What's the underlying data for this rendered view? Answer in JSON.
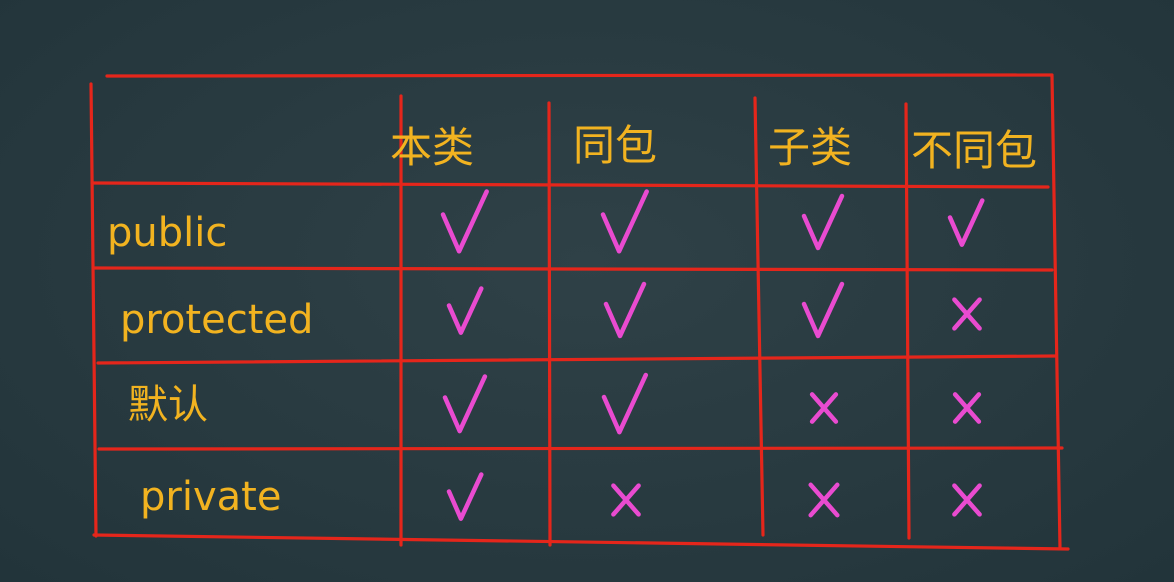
{
  "table": {
    "columns": [
      "本类",
      "同包",
      "子类",
      "不同包"
    ],
    "rows": [
      {
        "label": "public",
        "access": [
          true,
          true,
          true,
          true
        ]
      },
      {
        "label": "protected",
        "access": [
          true,
          true,
          true,
          false
        ]
      },
      {
        "label": "默认",
        "access": [
          true,
          true,
          false,
          false
        ]
      },
      {
        "label": "private",
        "access": [
          true,
          false,
          false,
          false
        ]
      }
    ]
  },
  "colors": {
    "board": "#283a40",
    "grid_lines": "#e5261b",
    "text": "#f2b320",
    "marks": "#e94bd0"
  },
  "icons": {
    "allowed": "check-mark",
    "denied": "cross-mark"
  }
}
